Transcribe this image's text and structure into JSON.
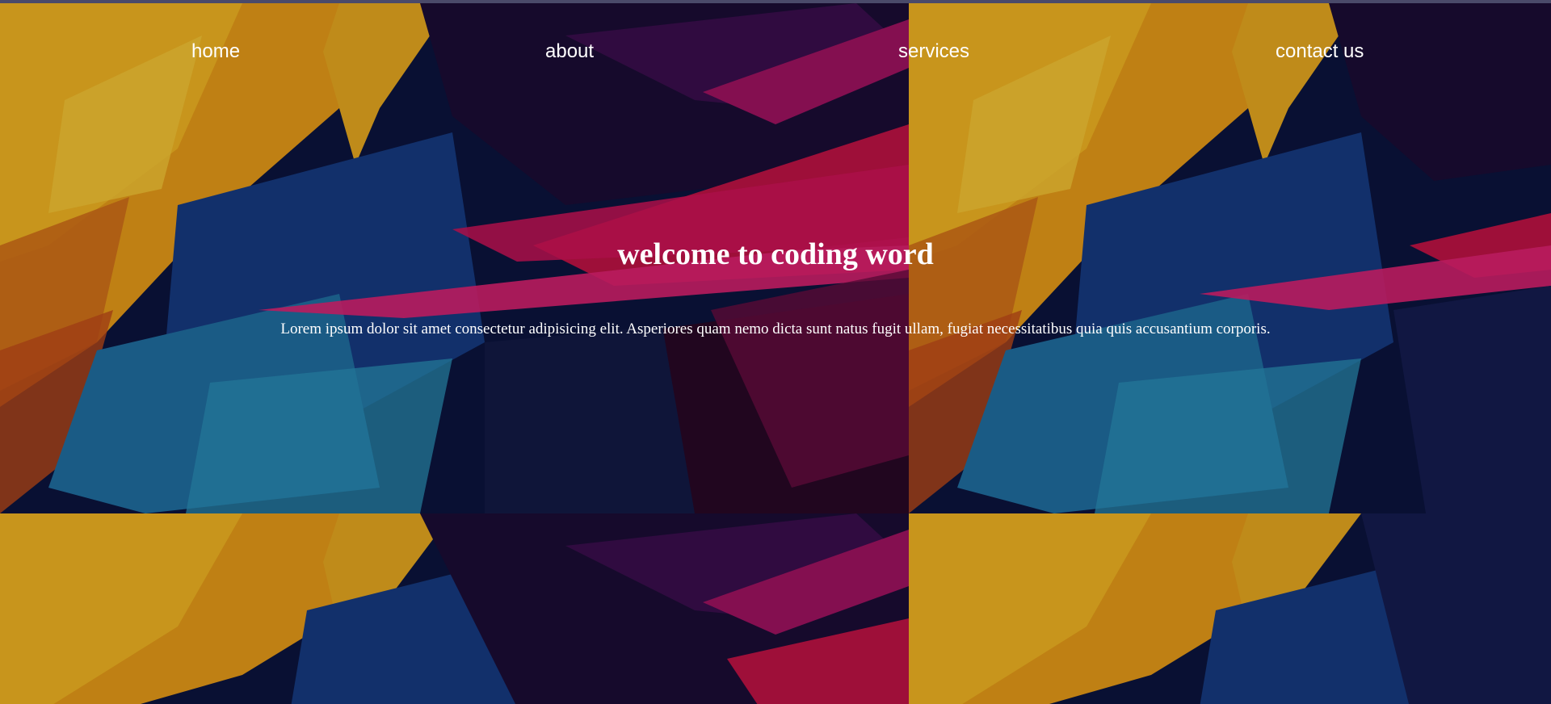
{
  "nav": {
    "items": [
      {
        "label": "home"
      },
      {
        "label": "about"
      },
      {
        "label": "services"
      },
      {
        "label": "contact us"
      }
    ]
  },
  "hero": {
    "title": "welcome to coding word",
    "description": "Lorem ipsum dolor sit amet consectetur adipisicing elit. Asperiores quam nemo dicta sunt natus fugit ullam, fugiat necessitatibus quia quis accusantium corporis."
  },
  "colors": {
    "text": "#ffffff",
    "background_dark": "#0b0f2a",
    "accent_orange": "#f0a010",
    "accent_magenta": "#d0105a",
    "accent_blue": "#1a4a8a"
  }
}
